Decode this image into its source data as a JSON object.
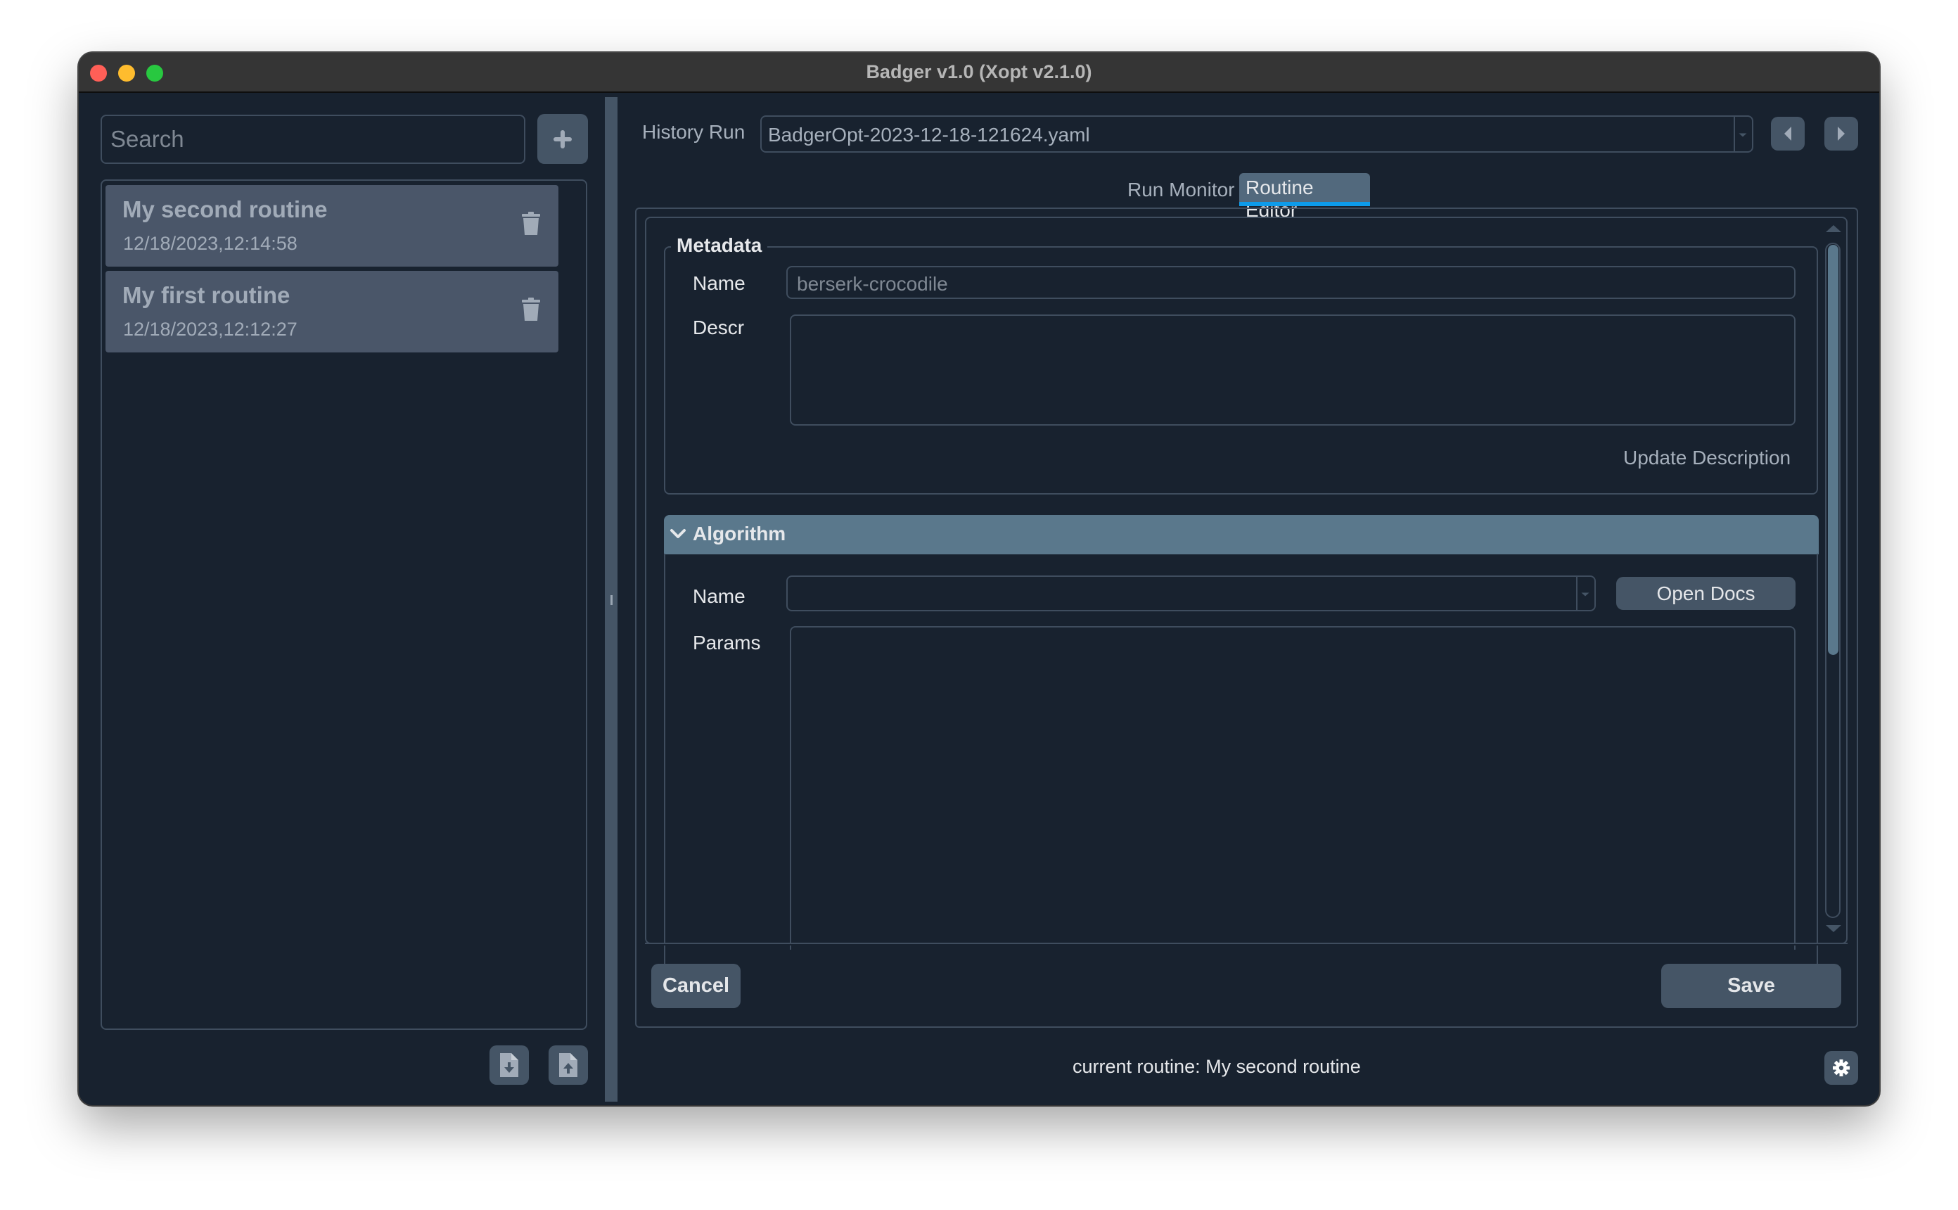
{
  "window": {
    "title": "Badger v1.0 (Xopt v2.1.0)",
    "traffic_lights": {
      "close": "#ff5f57",
      "minimize": "#febc2e",
      "zoom": "#28c840"
    }
  },
  "sidebar": {
    "search_placeholder": "Search",
    "add_icon": "plus-icon",
    "routines": [
      {
        "name": "My second routine",
        "timestamp": "12/18/2023,12:14:58",
        "delete_icon": "trash-icon"
      },
      {
        "name": "My first routine",
        "timestamp": "12/18/2023,12:12:27",
        "delete_icon": "trash-icon"
      }
    ],
    "import_icon": "file-import-icon",
    "export_icon": "file-export-icon"
  },
  "history": {
    "label": "History Run",
    "selected": "BadgerOpt-2023-12-18-121624.yaml",
    "prev_icon": "caret-left-icon",
    "next_icon": "caret-right-icon"
  },
  "tabs": [
    {
      "label": "Run Monitor",
      "active": false
    },
    {
      "label": "Routine Editor",
      "active": true
    }
  ],
  "colors": {
    "accent": "#0d9bea",
    "header": "#5a788c",
    "button": "#455566",
    "background": "#18222f"
  },
  "editor": {
    "metadata": {
      "title": "Metadata",
      "name_label": "Name",
      "name_value": "berserk-crocodile",
      "descr_label": "Descr",
      "descr_value": "",
      "update_button": "Update Description"
    },
    "algorithm": {
      "title": "Algorithm",
      "collapse_icon": "chevron-down-icon",
      "name_label": "Name",
      "name_value": "",
      "open_docs_button": "Open Docs",
      "params_label": "Params",
      "params_value": ""
    },
    "cancel_button": "Cancel",
    "save_button": "Save"
  },
  "status": {
    "text": "current routine: My second routine",
    "settings_icon": "gear-icon"
  }
}
